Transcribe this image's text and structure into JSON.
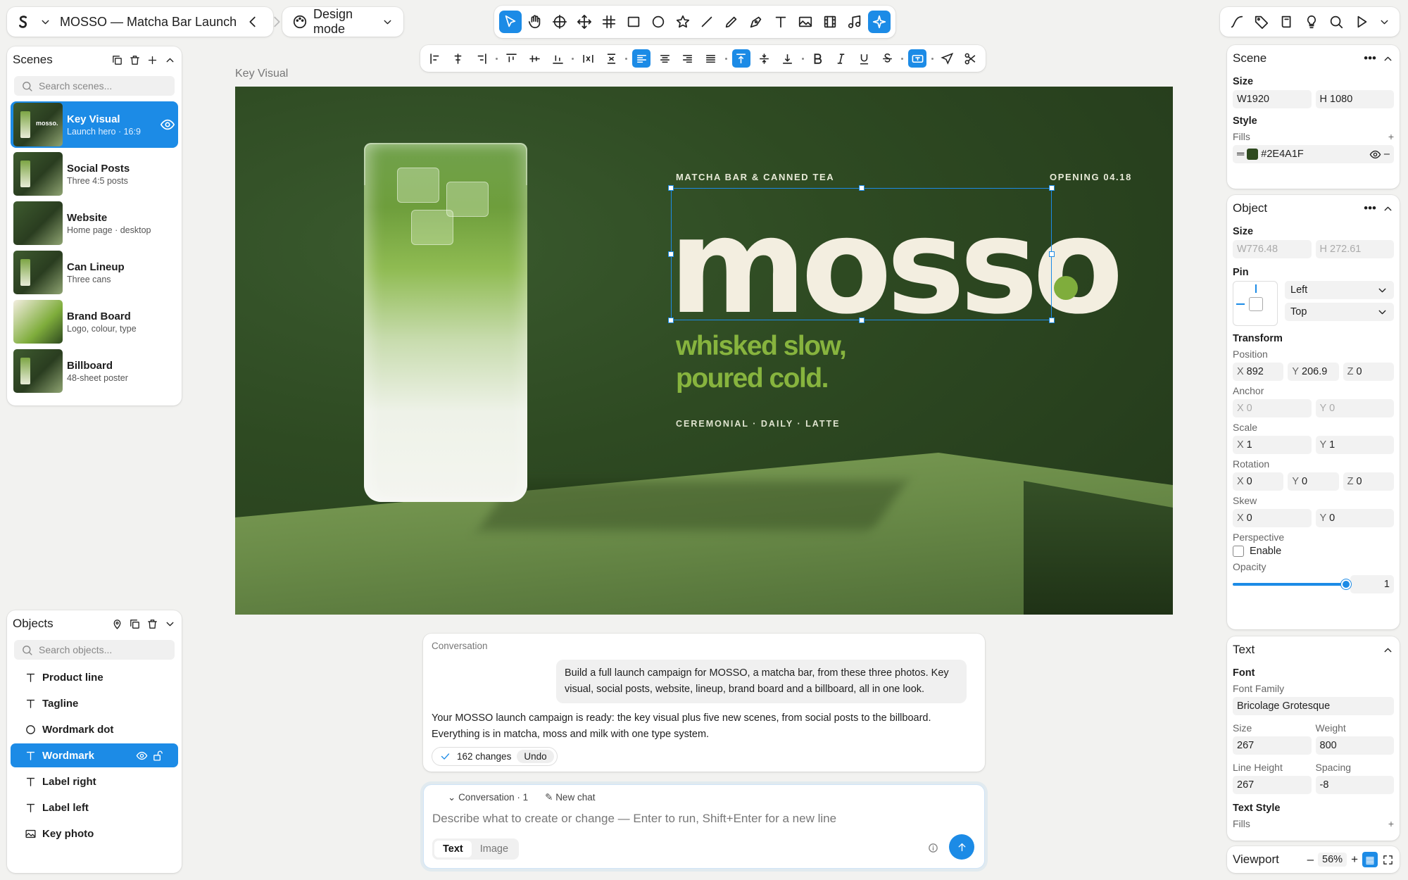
{
  "title_bar": {
    "project_title": "MOSSO — Matcha Bar Launch"
  },
  "mode": {
    "label": "Design mode"
  },
  "scenes": {
    "title": "Scenes",
    "search_placeholder": "Search scenes...",
    "items": [
      {
        "name": "Key Visual",
        "sub": "Launch hero · 16:9"
      },
      {
        "name": "Social Posts",
        "sub": "Three 4:5 posts"
      },
      {
        "name": "Website",
        "sub": "Home page · desktop"
      },
      {
        "name": "Can Lineup",
        "sub": "Three cans"
      },
      {
        "name": "Brand Board",
        "sub": "Logo, colour, type"
      },
      {
        "name": "Billboard",
        "sub": "48-sheet poster"
      }
    ]
  },
  "objects": {
    "title": "Objects",
    "search_placeholder": "Search objects...",
    "items": [
      {
        "label": "Product line",
        "icon": "text-icon"
      },
      {
        "label": "Tagline",
        "icon": "text-icon"
      },
      {
        "label": "Wordmark dot",
        "icon": "circle-icon"
      },
      {
        "label": "Wordmark",
        "icon": "text-icon"
      },
      {
        "label": "Label right",
        "icon": "text-icon"
      },
      {
        "label": "Label left",
        "icon": "text-icon"
      },
      {
        "label": "Key photo",
        "icon": "image-icon"
      }
    ]
  },
  "canvas": {
    "artboard_label": "Key Visual",
    "label_left": "MATCHA BAR & CANNED TEA",
    "label_right": "OPENING 04.18",
    "wordmark": "mosso",
    "tagline_1": "whisked slow,",
    "tagline_2": "poured cold.",
    "product_line": "CEREMONIAL · DAILY · LATTE"
  },
  "conversation": {
    "title": "Conversation",
    "user_message": "Build a full launch campaign for MOSSO, a matcha bar, from these three photos. Key visual, social posts, website, lineup, brand board and a billboard, all in one look.",
    "assistant_message": "Your MOSSO launch campaign is ready: the key visual plus five new scenes, from social posts to the billboard. Everything is in matcha, moss and milk with one type system.",
    "changes": "162 changes",
    "undo": "Undo"
  },
  "chat": {
    "conversation_count": "Conversation · 1",
    "new_chat": "New chat",
    "placeholder": "Describe what to create or change — Enter to run, Shift+Enter for a new line",
    "mode_text": "Text",
    "mode_image": "Image"
  },
  "scene_panel": {
    "title": "Scene",
    "size_label": "Size",
    "w": "W1920",
    "h": "H 1080",
    "style_label": "Style",
    "fills_label": "Fills",
    "fill_hex": "#2E4A1F",
    "fill_color": "#2E4A1F"
  },
  "object_panel": {
    "title": "Object",
    "size_label": "Size",
    "w": "W776.48",
    "h": "H 272.61",
    "pin_label": "Pin",
    "pin_h": "Left",
    "pin_v": "Top",
    "transform_label": "Transform",
    "position_label": "Position",
    "pos_x": "892",
    "pos_y": "206.9",
    "pos_z": "0",
    "anchor_label": "Anchor",
    "anchor_x": "0",
    "anchor_y": "0",
    "scale_label": "Scale",
    "scale_x": "1",
    "scale_y": "1",
    "rotation_label": "Rotation",
    "rot_x": "0",
    "rot_y": "0",
    "rot_z": "0",
    "skew_label": "Skew",
    "skew_x": "0",
    "skew_y": "0",
    "perspective_label": "Perspective",
    "enable_label": "Enable",
    "opacity_label": "Opacity",
    "opacity_value": "1",
    "opacity_fraction": 1.0
  },
  "text_panel": {
    "title": "Text",
    "font_label": "Font",
    "family_label": "Font Family",
    "family": "Bricolage Grotesque",
    "size_label": "Size",
    "size": "267",
    "weight_label": "Weight",
    "weight": "800",
    "line_height_label": "Line Height",
    "line_height": "267",
    "spacing_label": "Spacing",
    "spacing": "-8",
    "text_style_label": "Text Style",
    "fills_label": "Fills"
  },
  "viewport": {
    "label": "Viewport",
    "zoom": "56%"
  },
  "colors": {
    "accent": "#1c8be6",
    "artboard_bg": "#2E4A1F",
    "wordmark": "#f3eee0",
    "tagline": "#87b43e"
  }
}
